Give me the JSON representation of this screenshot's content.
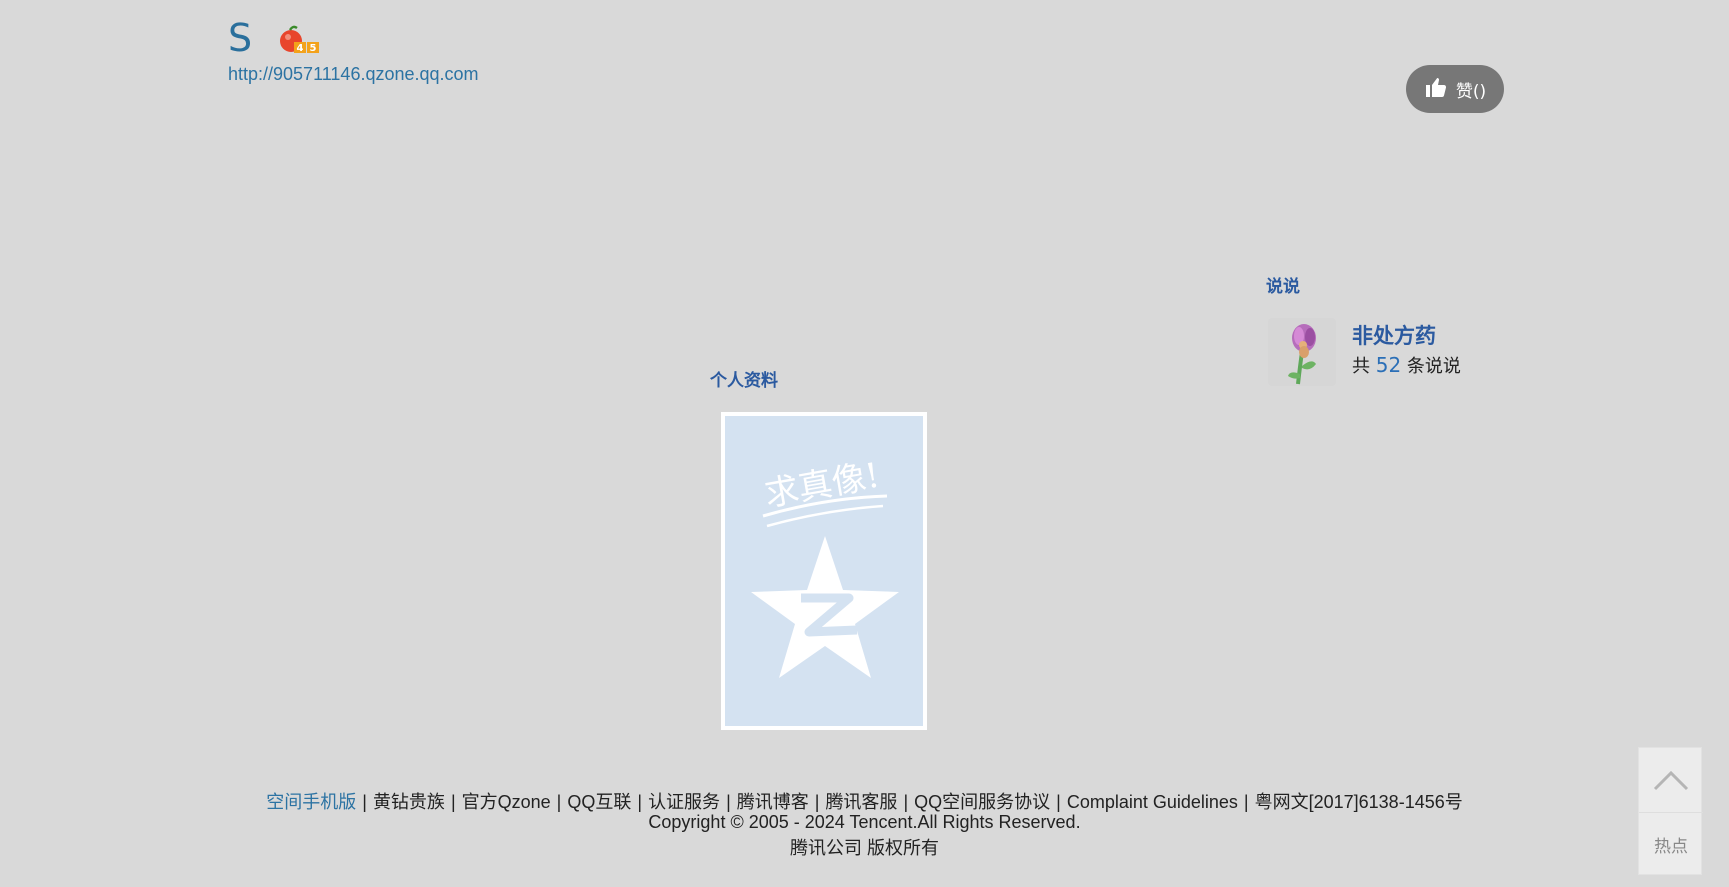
{
  "header": {
    "owner_name": "S",
    "space_url": "http://905711146.qzone.qq.com",
    "level_badge_digits": "45",
    "like_label": "赞()"
  },
  "shuoshuo": {
    "title": "说说",
    "name": "非处方药",
    "count_prefix": "共",
    "count": "52",
    "count_suffix": "条说说"
  },
  "profile": {
    "title": "个人资料",
    "photo_caption": "求真像!"
  },
  "footer": {
    "links": [
      "空间手机版",
      "黄钻贵族",
      "官方Qzone",
      "QQ互联",
      "认证服务",
      "腾讯博客",
      "腾讯客服",
      "QQ空间服务协议",
      "Complaint Guidelines",
      "粤网文[2017]6138-1456号"
    ],
    "separator": "|",
    "copyright": "Copyright © 2005 - 2024 Tencent.All Rights Reserved.",
    "company": "腾讯公司 版权所有"
  },
  "side_tools": {
    "back_to_top_icon": "chevron-up-icon",
    "hot_label": "热点"
  },
  "colors": {
    "background": "#d9d9d9",
    "link_blue": "#2c73a3",
    "title_blue": "#2b5aa0",
    "like_button": "#777777"
  }
}
